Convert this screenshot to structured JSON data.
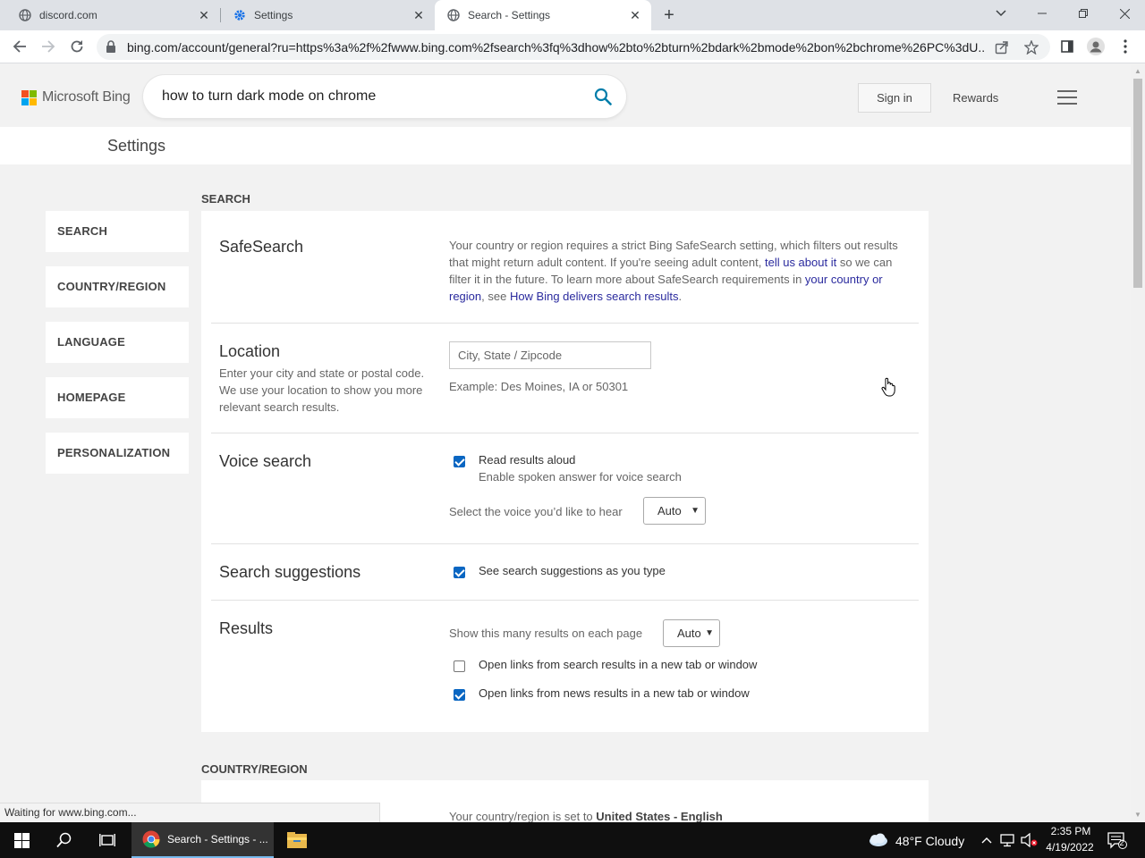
{
  "browser": {
    "tabs": [
      {
        "title": "discord.com",
        "active": false
      },
      {
        "title": "Settings",
        "active": false
      },
      {
        "title": "Search - Settings",
        "active": true
      }
    ],
    "url": "bing.com/account/general?ru=https%3a%2f%2fwww.bing.com%2fsearch%3fq%3dhow%2bto%2bturn%2bdark%2bmode%2bon%2bchrome%26PC%3dU..."
  },
  "bing": {
    "logo_text": "Microsoft Bing",
    "search_query": "how to turn dark mode on chrome",
    "sign_in": "Sign in",
    "rewards": "Rewards",
    "brand_colors": {
      "red": "#f25022",
      "green": "#7fba00",
      "blue": "#00a4ef",
      "yellow": "#ffb900"
    }
  },
  "settings": {
    "page_title": "Settings",
    "side_nav": [
      "SEARCH",
      "COUNTRY/REGION",
      "LANGUAGE",
      "HOMEPAGE",
      "PERSONALIZATION"
    ],
    "search_section_title": "SEARCH",
    "safesearch": {
      "title": "SafeSearch",
      "text_1": "Your country or region requires a strict Bing SafeSearch setting, which filters out results that might return adult content. If you're seeing adult content, ",
      "link_tell_us": "tell us about it",
      "text_2": " so we can filter it in the future. To learn more about SafeSearch requirements in ",
      "link_country": "your country or region",
      "text_3": ", see ",
      "link_delivers": "How Bing delivers search results",
      "text_4": "."
    },
    "location": {
      "title": "Location",
      "description": "Enter your city and state or postal code. We use your location to show you more relevant search results.",
      "placeholder": "City, State / Zipcode",
      "example": "Example: Des Moines, IA or 50301"
    },
    "voice_search": {
      "title": "Voice search",
      "read_aloud_label": "Read results aloud",
      "read_aloud_checked": true,
      "read_aloud_sub": "Enable spoken answer for voice search",
      "voice_label": "Select the voice you’d like to hear",
      "voice_value": "Auto"
    },
    "search_suggestions": {
      "title": "Search suggestions",
      "label": "See search suggestions as you type",
      "checked": true
    },
    "results": {
      "title": "Results",
      "per_page_label": "Show this many results on each page",
      "per_page_value": "Auto",
      "new_tab_search_label": "Open links from search results in a new tab or window",
      "new_tab_search_checked": false,
      "new_tab_news_label": "Open links from news results in a new tab or window",
      "new_tab_news_checked": true
    },
    "country_section_title": "COUNTRY/REGION",
    "country_text": "Your country/region is set to ",
    "country_value": "United States - English"
  },
  "status_bar": "Waiting for www.bing.com...",
  "taskbar": {
    "chrome_label": "Search - Settings - ...",
    "weather": "48°F  Cloudy",
    "time": "2:35 PM",
    "date": "4/19/2022",
    "notification_count": "2"
  }
}
